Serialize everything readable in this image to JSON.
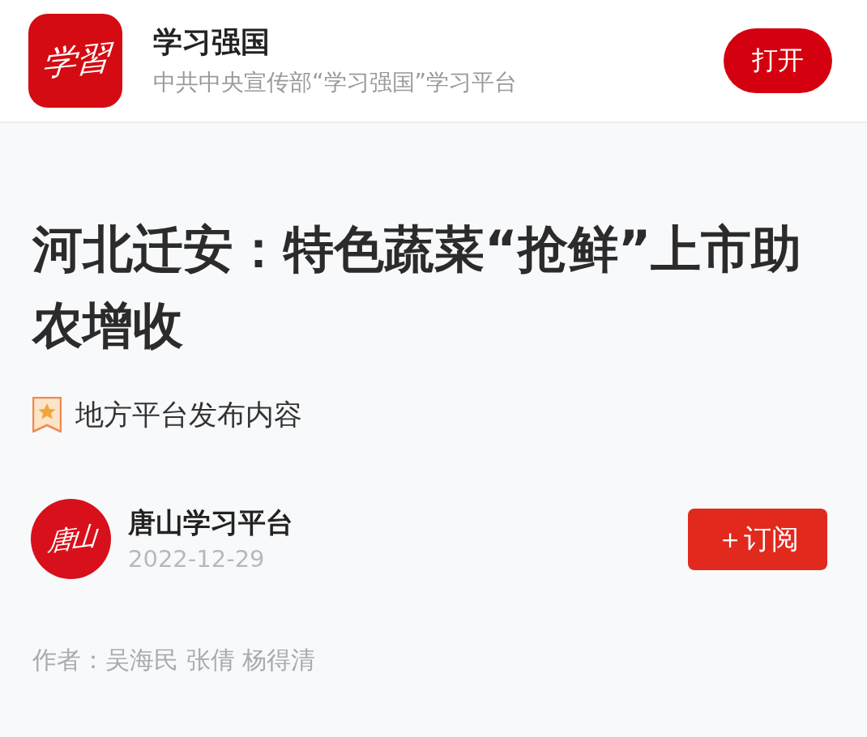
{
  "app_banner": {
    "logo_text": "学習",
    "title": "学习强国",
    "subtitle": "中共中央宣传部“学习强国”学习平台",
    "open_button": "打开"
  },
  "article": {
    "title": "河北迁安：特色蔬菜“抢鲜”上市助农增收",
    "source_tag": "地方平台发布内容",
    "publisher": {
      "avatar_text": "唐山",
      "name": "唐山学习平台",
      "date": "2022-12-29",
      "subscribe_button": "＋订阅"
    },
    "byline": "作者：吴海民 张倩 杨得清"
  }
}
